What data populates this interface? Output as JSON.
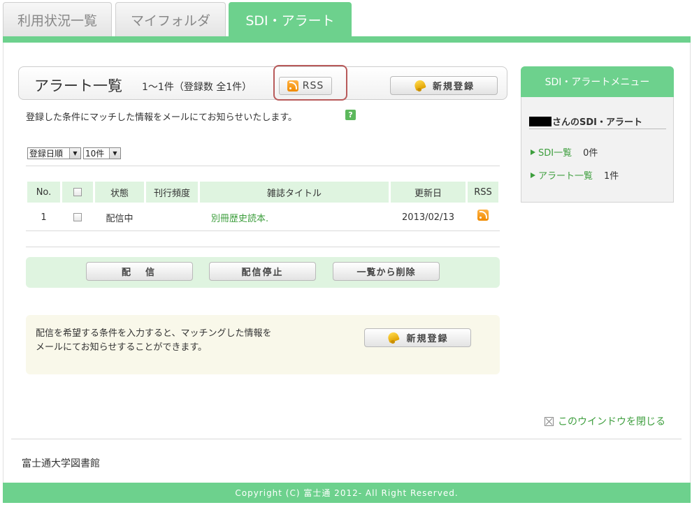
{
  "tabs": [
    {
      "label": "利用状況一覧"
    },
    {
      "label": "マイフォルダ"
    },
    {
      "label": "SDI・アラート"
    }
  ],
  "header": {
    "title": "アラート一覧",
    "count": "1～1件（登録数 全1件）",
    "rss_label": "RSS",
    "register_label": "新規登録"
  },
  "description": "登録した条件にマッチした情報をメールにてお知らせいたします。",
  "help_label": "?",
  "filters": {
    "sort": "登録日順",
    "per_page": "10件"
  },
  "table": {
    "headers": {
      "no": "No.",
      "status": "状態",
      "frequency": "刊行頻度",
      "title": "雑誌タイトル",
      "updated": "更新日",
      "rss": "RSS"
    },
    "rows": [
      {
        "no": "1",
        "status": "配信中",
        "frequency": "",
        "title": "別冊歴史読本.",
        "updated": "2013/02/13"
      }
    ]
  },
  "actions": {
    "deliver": "配　信",
    "stop": "配信停止",
    "delete": "一覧から削除"
  },
  "info": {
    "line1": "配信を希望する条件を入力すると、マッチングした情報を",
    "line2": "メールにてお知らせすることができます。",
    "register_label": "新規登録"
  },
  "sidebar": {
    "title": "SDI・アラートメニュー",
    "user_suffix": "さんのSDI・アラート",
    "items": [
      {
        "label": "SDI一覧",
        "count": "0件"
      },
      {
        "label": "アラート一覧",
        "count": "1件"
      }
    ]
  },
  "close_window": "このウインドウを閉じる",
  "organization": "富士通大学図書館",
  "footer": "Copyright (C) 富士通 2012- All Right Reserved."
}
